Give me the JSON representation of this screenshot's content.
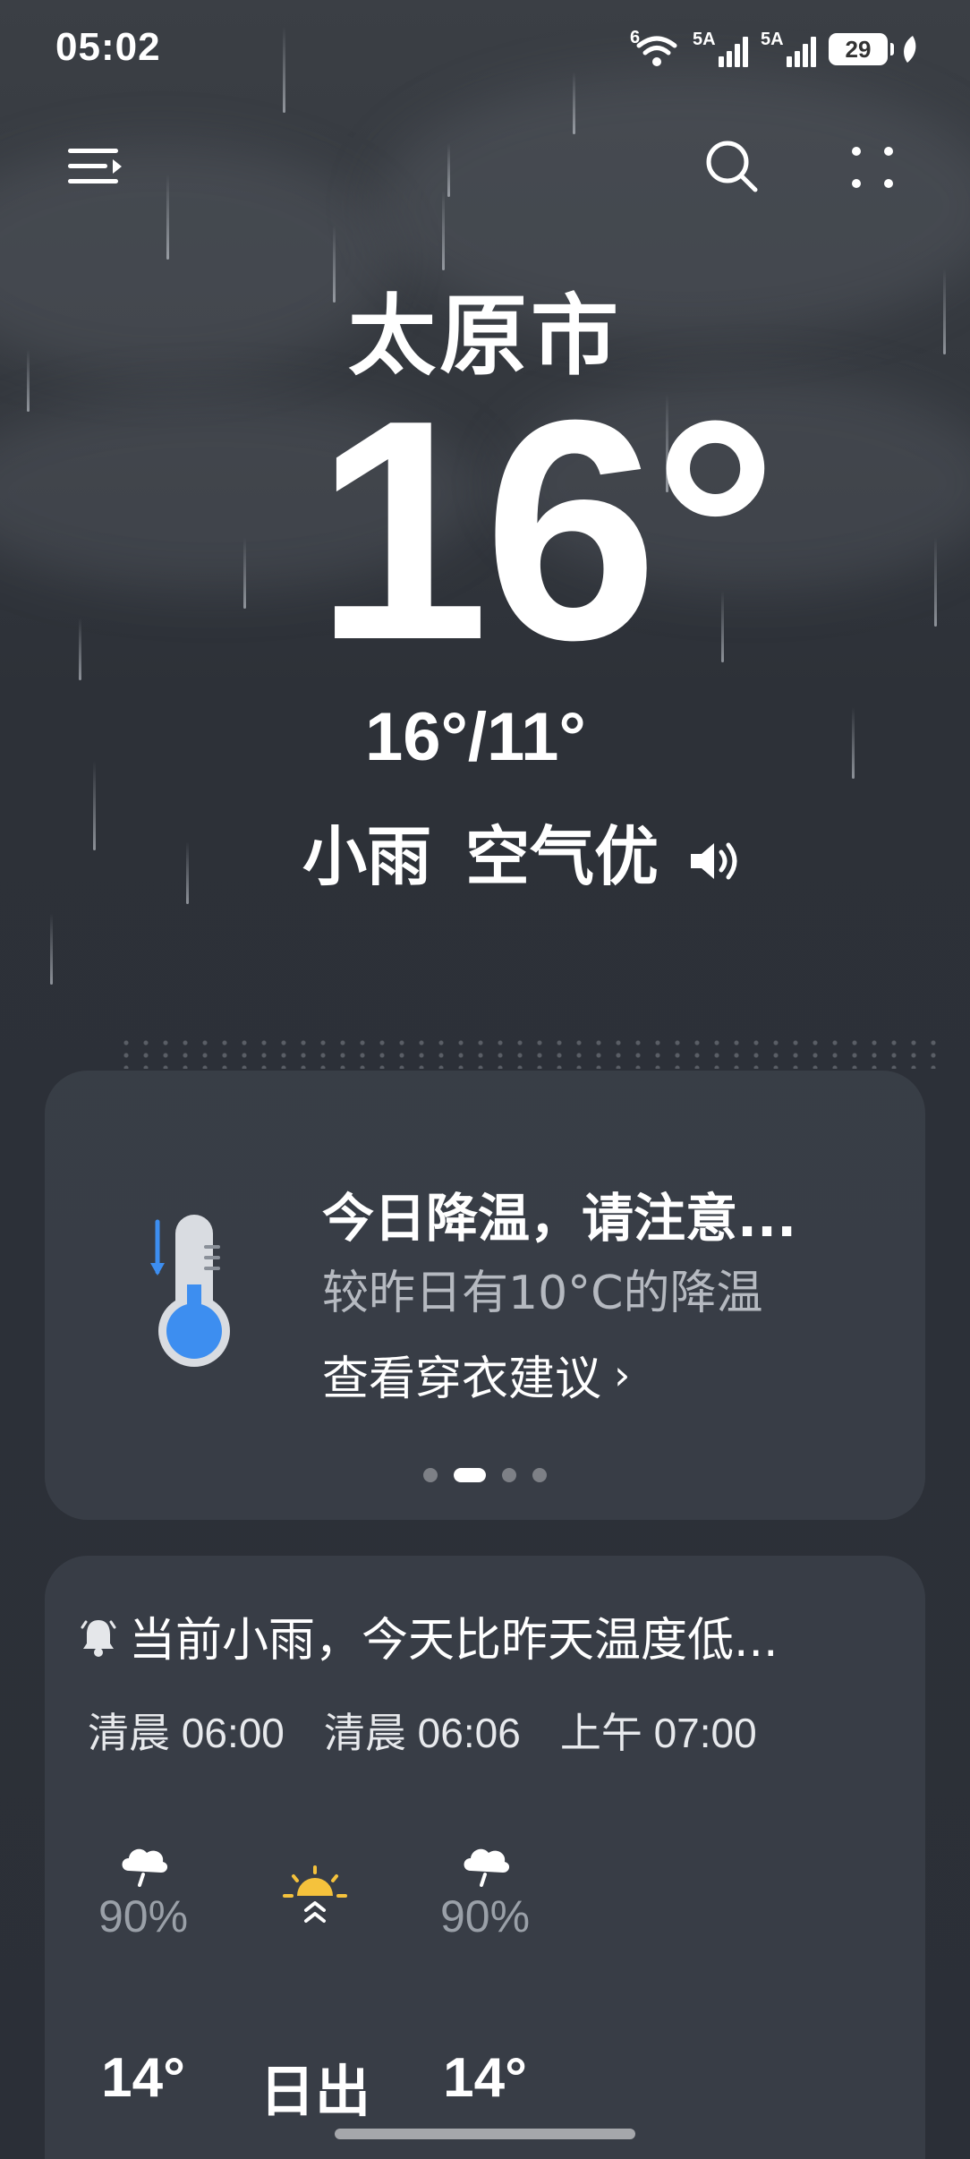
{
  "status_bar": {
    "time": "05:02",
    "wifi_label": "6",
    "sim1_network": "5A",
    "sim2_network": "5A",
    "battery": "29"
  },
  "header": {
    "menu_icon": "menu-icon",
    "search_icon": "search-icon",
    "more_icon": "more-icon"
  },
  "weather": {
    "city": "太原市",
    "temperature": "16°",
    "high_low": "16°/11°",
    "condition": "小雨",
    "air_quality": "空气优",
    "speaker_icon": "speaker-icon"
  },
  "alert_card": {
    "icon": "thermometer-cold-icon",
    "title": "今日降温，请注意...",
    "subtitle": "较昨日有10°C的降温",
    "link_label": "查看穿衣建议",
    "link_arrow": "›",
    "page_count": 4,
    "active_page": 2
  },
  "hourly_card": {
    "bell_icon": "bell-icon",
    "notice": "当前小雨，今天比昨天温度低...",
    "times": [
      "清晨 06:00",
      "清晨 06:06",
      "上午 07:00"
    ],
    "items": [
      {
        "icon": "rain-cloud-icon",
        "precip": "90%",
        "value": "14°"
      },
      {
        "icon": "sunrise-icon",
        "precip": "",
        "value": "日出"
      },
      {
        "icon": "rain-cloud-icon",
        "precip": "90%",
        "value": "14°"
      }
    ]
  },
  "colors": {
    "background": "#2d3138",
    "card": "#3a3f48",
    "muted_text": "#b5b9c0",
    "percent_text": "#9aa0a8",
    "thermometer_blue": "#3d8ef0",
    "sun_yellow": "#f5c23c"
  }
}
